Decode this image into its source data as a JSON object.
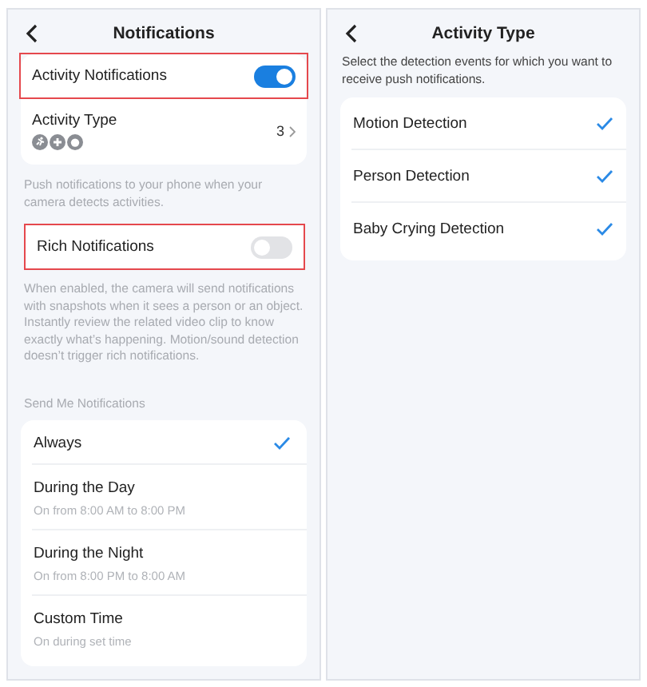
{
  "notifications_screen": {
    "title": "Notifications",
    "settings_card": [
      {
        "kind": "toggle",
        "label": "Activity Notifications",
        "on": true,
        "highlighted": true
      },
      {
        "kind": "link",
        "label": "Activity Type",
        "value": "3",
        "highlighted": false
      }
    ],
    "activity_hint": "Push notifications to your phone when your camera detects activities.",
    "rich_notifications": {
      "label": "Rich Notifications",
      "on": false,
      "highlighted": true
    },
    "rich_hint": "When enabled, the camera will send notifications with snapshots when it sees a person or an object. Instantly review the related video clip to know exactly what’s happening. Motion/sound detection doesn’t trigger rich notifications.",
    "schedule_heading": "Send Me Notifications",
    "schedule_options": [
      {
        "label": "Always",
        "selected": true
      },
      {
        "label": "During the Day",
        "detail": "On from 8:00 AM to 8:00 PM",
        "selected": false
      },
      {
        "label": "During the Night",
        "detail": "On from 8:00 PM to 8:00 AM",
        "selected": false
      },
      {
        "label": "Custom Time",
        "detail": "On during set time",
        "selected": false
      }
    ]
  },
  "activity_type_screen": {
    "title": "Activity Type",
    "description": "Select the detection events for which you want to receive push notifications.",
    "events": [
      {
        "label": "Motion Detection",
        "checked": true
      },
      {
        "label": "Person Detection",
        "checked": true
      },
      {
        "label": "Baby Crying Detection",
        "checked": true
      }
    ]
  }
}
